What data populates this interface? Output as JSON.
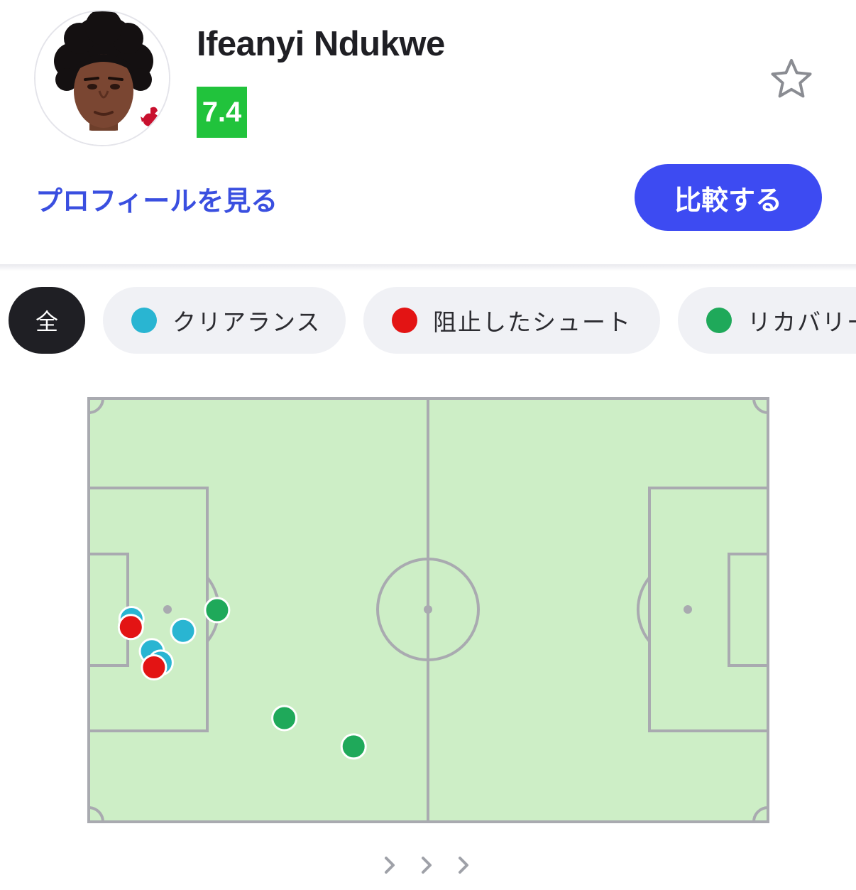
{
  "player": {
    "name": "Ifeanyi Ndukwe",
    "rating": "7.4",
    "club_badge_text": "L.F.C."
  },
  "actions": {
    "profile_link": "プロフィールを見る",
    "compare_button": "比較する",
    "favorite_icon": "star-outline-icon"
  },
  "filters": [
    {
      "label": "全",
      "selected": true
    },
    {
      "label": "クリアランス",
      "color": "#29b5d2"
    },
    {
      "label": "阻止したシュート",
      "color": "#e31414"
    },
    {
      "label": "リカバリー",
      "color": "#1fa95a"
    }
  ],
  "colors": {
    "accent": "#3d4bf2",
    "rating": "#21c33c",
    "pitch": "#cdeec6",
    "pitch_lines": "#a9aab0"
  },
  "chart_data": {
    "type": "scatter",
    "title": "",
    "xlabel": "",
    "ylabel": "",
    "xlim": [
      0,
      100
    ],
    "ylim": [
      0,
      100
    ],
    "series": [
      {
        "name": "クリアランス",
        "color": "#29b5d2",
        "points": [
          [
            6.3,
            47.9
          ],
          [
            13.9,
            45.1
          ],
          [
            9.3,
            40.3
          ],
          [
            10.6,
            37.6
          ]
        ]
      },
      {
        "name": "阻止したシュート",
        "color": "#e31414",
        "points": [
          [
            6.2,
            46.0
          ],
          [
            9.6,
            36.5
          ]
        ]
      },
      {
        "name": "リカバリー",
        "color": "#1fa95a",
        "points": [
          [
            18.9,
            50.0
          ],
          [
            28.8,
            24.5
          ],
          [
            39.0,
            17.8
          ]
        ]
      }
    ]
  },
  "pager": {
    "icon": "chevron-right-icon",
    "count": 3
  }
}
